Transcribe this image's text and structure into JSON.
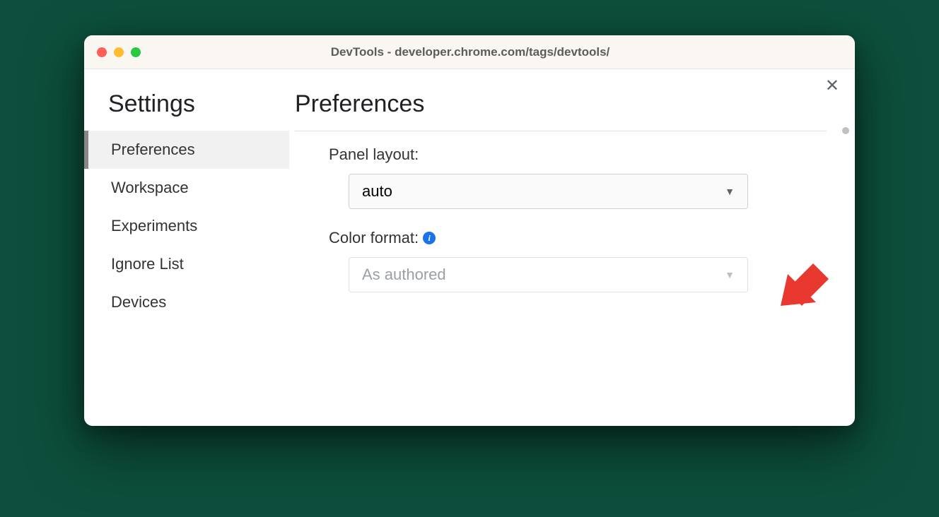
{
  "window": {
    "title": "DevTools - developer.chrome.com/tags/devtools/"
  },
  "sidebar": {
    "title": "Settings",
    "items": [
      {
        "label": "Preferences",
        "active": true
      },
      {
        "label": "Workspace",
        "active": false
      },
      {
        "label": "Experiments",
        "active": false
      },
      {
        "label": "Ignore List",
        "active": false
      },
      {
        "label": "Devices",
        "active": false
      }
    ]
  },
  "main": {
    "title": "Preferences",
    "settings": {
      "panel_layout": {
        "label": "Panel layout:",
        "value": "auto"
      },
      "color_format": {
        "label": "Color format:",
        "value": "As authored",
        "has_info": true,
        "disabled": true
      }
    }
  }
}
